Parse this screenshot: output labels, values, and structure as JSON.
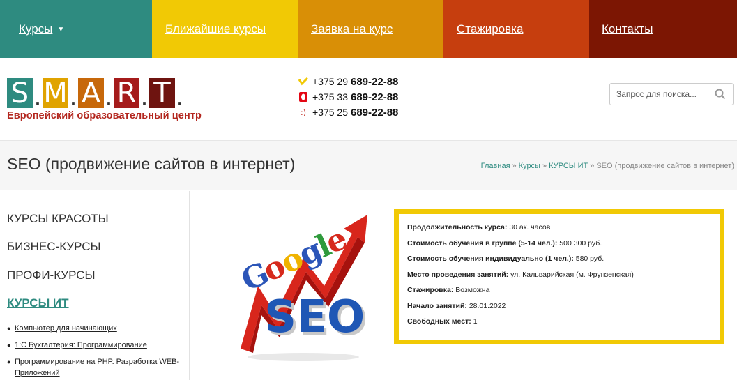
{
  "nav": {
    "courses": "Курсы",
    "nearest": "Ближайшие курсы",
    "apply": "Заявка на курс",
    "internship": "Стажировка",
    "contacts": "Контакты"
  },
  "logo": {
    "letters": [
      "S",
      "M",
      "A",
      "R",
      "T"
    ],
    "subtitle": "Европейский образовательный центр"
  },
  "phones": [
    {
      "operator_icon": "velcom-icon",
      "prefix": "+375 29",
      "number": "689-22-88",
      "color": "#f1c905"
    },
    {
      "operator_icon": "mts-icon",
      "prefix": "+375 33",
      "number": "689-22-88",
      "color": "#e30613"
    },
    {
      "operator_icon": "life-icon",
      "prefix": "+375 25",
      "number": "689-22-88",
      "color": "#c0261d"
    }
  ],
  "search": {
    "placeholder": "Запрос для поиска..."
  },
  "page": {
    "title": "SEO (продвижение сайтов в интернет)",
    "breadcrumbs": [
      "Главная",
      "Курсы",
      "КУРСЫ ИТ"
    ],
    "breadcrumb_sep": "»",
    "breadcrumb_current": "SEO (продвижение сайтов в интернет)"
  },
  "sidebar": {
    "categories": [
      "КУРСЫ КРАСОТЫ",
      "БИЗНЕС-КУРСЫ",
      "ПРОФИ-КУРСЫ",
      "КУРСЫ ИТ"
    ],
    "active": "КУРСЫ ИТ",
    "subitems": [
      "Компьютер для начинающих",
      "1:С Бухгалтерия: Программирование",
      "Программирование на PHP. Разработка WEB-Приложений"
    ]
  },
  "hero": {
    "word1": "Google",
    "word2": "SEO"
  },
  "info": {
    "duration_label": "Продолжительность курса:",
    "duration_value": "30 ак. часов",
    "group_label": "Стоимость обучения в группе (5-14 чел.):",
    "group_old": "500",
    "group_value": "300 руб.",
    "individual_label": "Стоимость обучения индивидуально (1 чел.):",
    "individual_value": "580 руб.",
    "place_label": "Место проведения занятий:",
    "place_value": "ул. Кальварийская (м. Фрунзенская)",
    "internship_label": "Стажировка:",
    "internship_value": "Возможна",
    "start_label": "Начало занятий:",
    "start_value": "28.01.2022",
    "seats_label": "Свободных мест:",
    "seats_value": "1"
  },
  "colors": {
    "teal": "#2e8b80",
    "yellow": "#f1c905",
    "orange": "#d98f06",
    "red": "#c63e0e",
    "maroon": "#7c1603"
  }
}
